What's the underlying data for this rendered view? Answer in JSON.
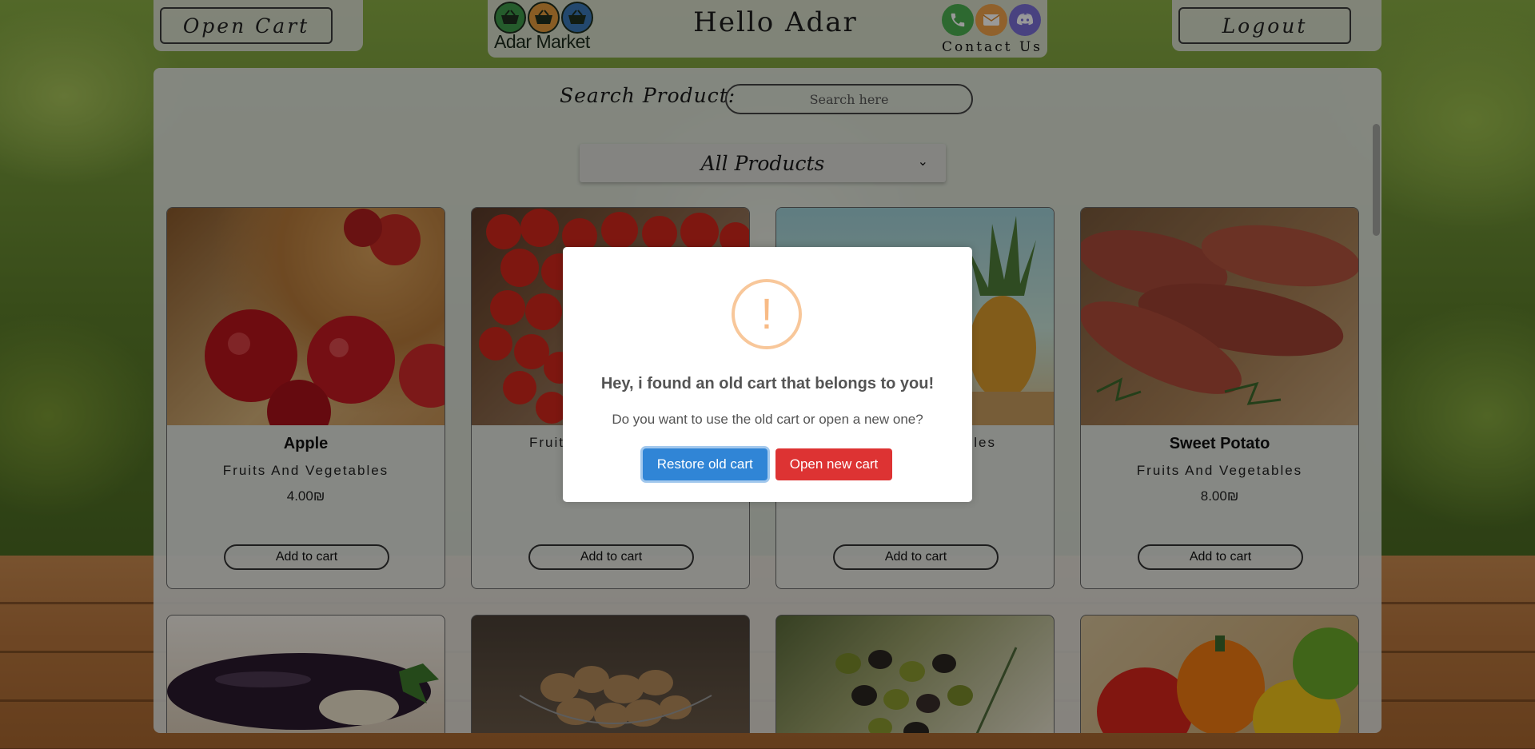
{
  "header": {
    "open_cart_label": "Open Cart",
    "logout_label": "Logout",
    "logo_text": "Adar Market",
    "greeting": "Hello Adar",
    "contact_label": "Contact Us"
  },
  "search": {
    "label": "Search  Product:",
    "placeholder": "Search here"
  },
  "category_select": {
    "selected": "All Products"
  },
  "products": [
    {
      "name": "Apple",
      "category": "Fruits And Vegetables",
      "price": "4.00₪",
      "button": "Add to cart",
      "image": "apples-in-basket"
    },
    {
      "name": "",
      "category": "Fruit",
      "price": "",
      "button": "Add to cart",
      "image": "cherry-tomatoes"
    },
    {
      "name": "",
      "category": "bles",
      "price": "",
      "button": "Add to cart",
      "image": "pineapple"
    },
    {
      "name": "Sweet Potato",
      "category": "Fruits And Vegetables",
      "price": "8.00₪",
      "button": "Add to cart",
      "image": "sweet-potatoes"
    }
  ],
  "products_row2": [
    "eggplant",
    "potatoes-basket",
    "olives",
    "bell-peppers"
  ],
  "modal": {
    "icon": "warning-icon",
    "icon_glyph": "!",
    "title": "Hey, i found an old cart that belongs to you!",
    "text": "Do you want to use the old cart or open a new one?",
    "confirm_label": "Restore old cart",
    "cancel_label": "Open new cart",
    "confirm_color": "#3085d6",
    "cancel_color": "#dd3333"
  },
  "colors": {
    "panel": "#e6e8e4",
    "overlay": "rgba(0,0,0,0.4)"
  }
}
